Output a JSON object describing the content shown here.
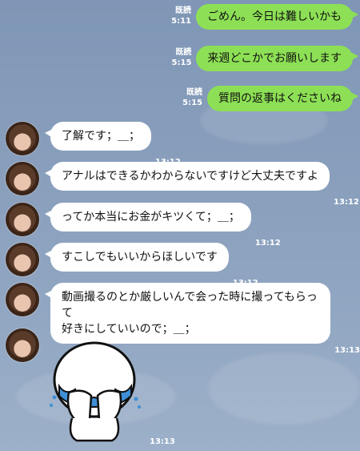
{
  "sent": [
    {
      "read": "既読",
      "time": "5:11",
      "text": "ごめん。今日は難しいかも"
    },
    {
      "read": "既読",
      "time": "5:15",
      "text": "来週どこかでお願いします"
    },
    {
      "read": "既読",
      "time": "5:15",
      "text": "質問の返事はくださいね"
    }
  ],
  "received": [
    {
      "text": "了解です；＿；",
      "time": "13:12"
    },
    {
      "text": "アナルはできるかわからないですけど大丈夫ですよ",
      "time": "13:12"
    },
    {
      "text": "ってか本当にお金がキツくて；＿；",
      "time": "13:12"
    },
    {
      "text": "すこしでもいいからほしいです",
      "time": "13:12"
    },
    {
      "line1": "動画撮るのとか厳しいんで会った時に撮ってもらって",
      "line2": "好きにしていいので；＿；",
      "time": "13:13"
    }
  ],
  "sticker": {
    "time": "13:13",
    "icon": "crying-face-sticker-icon"
  },
  "colors": {
    "sent_bubble": "#8de055",
    "received_bubble": "#ffffff",
    "background": "#8aa0bd"
  }
}
